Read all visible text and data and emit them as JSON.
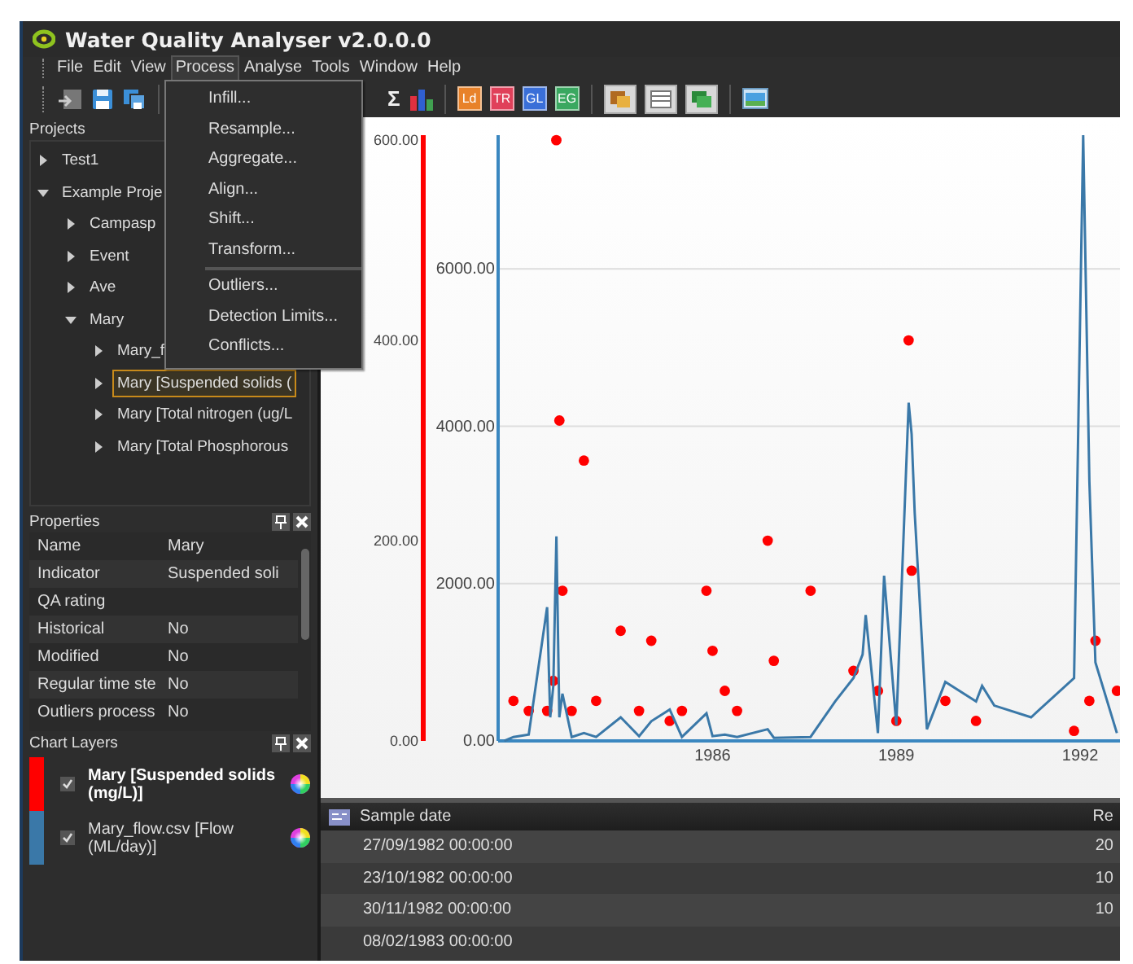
{
  "window": {
    "title": "Water Quality Analyser v2.0.0.0"
  },
  "menu_bar": [
    {
      "label": "File",
      "open": false
    },
    {
      "label": "Edit",
      "open": false
    },
    {
      "label": "View",
      "open": false
    },
    {
      "label": "Process",
      "open": true
    },
    {
      "label": "Analyse",
      "open": false
    },
    {
      "label": "Tools",
      "open": false
    },
    {
      "label": "Window",
      "open": false
    },
    {
      "label": "Help",
      "open": false
    }
  ],
  "process_menu": [
    {
      "label": "Infill..."
    },
    {
      "label": "Resample..."
    },
    {
      "label": "Aggregate..."
    },
    {
      "label": "Align..."
    },
    {
      "label": "Shift..."
    },
    {
      "label": "Transform...",
      "separator_after": true
    },
    {
      "label": "Outliers..."
    },
    {
      "label": "Detection Limits..."
    },
    {
      "label": "Conflicts..."
    }
  ],
  "toolbar": {
    "symbol": "Σ",
    "letter_buttons": [
      {
        "label": "Ld",
        "color": "#e8822a"
      },
      {
        "label": "TR",
        "color": "#e0405a"
      },
      {
        "label": "GL",
        "color": "#3a6fd8"
      },
      {
        "label": "EG",
        "color": "#3aa860"
      }
    ]
  },
  "projects": {
    "title": "Projects",
    "items": [
      {
        "label": "Test1",
        "expanded": false,
        "selected": false
      },
      {
        "label": "Example Proje",
        "expanded": true,
        "selected": false,
        "children": [
          {
            "label": "Campasp",
            "expanded": false,
            "selected": false
          },
          {
            "label": "Event",
            "expanded": false,
            "selected": false
          },
          {
            "label": "Ave",
            "expanded": false,
            "selected": false
          },
          {
            "label": "Mary",
            "expanded": true,
            "selected": false,
            "children": [
              {
                "label": "Mary_f",
                "expanded": false,
                "selected": false
              },
              {
                "label": "Mary [Suspended solids (",
                "expanded": false,
                "selected": true
              },
              {
                "label": "Mary [Total nitrogen (ug/L",
                "expanded": false,
                "selected": false
              },
              {
                "label": "Mary [Total Phosphorous",
                "expanded": false,
                "selected": false
              }
            ]
          }
        ]
      }
    ]
  },
  "properties": {
    "title": "Properties",
    "rows": [
      {
        "name": "Name",
        "value": "Mary"
      },
      {
        "name": "Indicator",
        "value": "Suspended soli"
      },
      {
        "name": "QA rating"
      },
      {
        "name": "Historical",
        "value": "No"
      },
      {
        "name": "Modified",
        "value": "No"
      },
      {
        "name": "Regular time ste",
        "value": "No"
      },
      {
        "name": "Outliers process",
        "value": "No"
      }
    ]
  },
  "chart_layers": {
    "title": "Chart Layers",
    "layers": [
      {
        "checked": true,
        "selected": true
      },
      {
        "checked": true,
        "selected": false
      }
    ]
  },
  "chart": {
    "chart_data": {
      "type": "line",
      "x": [
        1982.6,
        1982.75,
        1983.0,
        1983.3,
        1983.35,
        1983.4,
        1983.45,
        1983.5,
        1983.55,
        1983.7,
        1983.9,
        1984.1,
        1984.5,
        1984.8,
        1985.0,
        1985.3,
        1985.5,
        1985.9,
        1986.0,
        1986.2,
        1986.4,
        1986.9,
        1987.0,
        1987.6,
        1988.0,
        1988.3,
        1988.45,
        1988.5,
        1988.7,
        1988.8,
        1989.0,
        1989.2,
        1989.25,
        1989.3,
        1989.5,
        1989.8,
        1990.3,
        1990.4,
        1990.6,
        1991.2,
        1991.9,
        1992.05,
        1992.15,
        1992.25,
        1992.6
      ],
      "series": [
        {
          "name": "Mary [Suspended solids (mg/L)]",
          "color": "#ff0000",
          "type": "scatter",
          "axis": "y2",
          "values": [
            null,
            40,
            30,
            30,
            null,
            60,
            600,
            320,
            150,
            30,
            280,
            40,
            110,
            30,
            100,
            20,
            30,
            150,
            90,
            50,
            30,
            200,
            80,
            150,
            null,
            70,
            null,
            null,
            50,
            null,
            20,
            400,
            170,
            null,
            null,
            40,
            20,
            null,
            null,
            null,
            10,
            null,
            40,
            100,
            50
          ]
        },
        {
          "name": "Mary_flow.csv [Flow (ML/day)]",
          "color": "#3a78a8",
          "type": "line",
          "values": [
            0,
            50,
            80,
            1700,
            300,
            700,
            2600,
            300,
            600,
            50,
            100,
            50,
            300,
            60,
            250,
            400,
            50,
            350,
            60,
            80,
            50,
            150,
            40,
            50,
            500,
            800,
            1100,
            1600,
            100,
            2100,
            200,
            4300,
            3900,
            2900,
            150,
            750,
            500,
            700,
            450,
            300,
            800,
            7700,
            3300,
            1000,
            100
          ]
        }
      ],
      "grid": true,
      "xlim": [
        1982.5,
        1992.65
      ],
      "ylim": [
        0,
        7700
      ],
      "y2lim": [
        0,
        605
      ],
      "xticks": [
        1986,
        1989,
        1992
      ],
      "yticks": [
        {
          "value": 0,
          "label": "0.00"
        },
        {
          "value": 2000,
          "label": "2000.00"
        },
        {
          "value": 4000,
          "label": "4000.00"
        },
        {
          "value": 6000,
          "label": "6000.00"
        }
      ],
      "y2ticks": [
        {
          "value": 0,
          "label": "0.00"
        },
        {
          "value": 200,
          "label": "200.00"
        },
        {
          "value": 400,
          "label": "400.00"
        },
        {
          "value": 600,
          "label": "600.00"
        }
      ]
    }
  },
  "table": {
    "columns": [
      "Sample date",
      "Re"
    ],
    "rows": [
      [
        "27/09/1982 00:00:00",
        "20"
      ],
      [
        "23/10/1982 00:00:00",
        "10"
      ],
      [
        "30/11/1982 00:00:00",
        "10"
      ],
      [
        "08/02/1983 00:00:00"
      ]
    ]
  }
}
